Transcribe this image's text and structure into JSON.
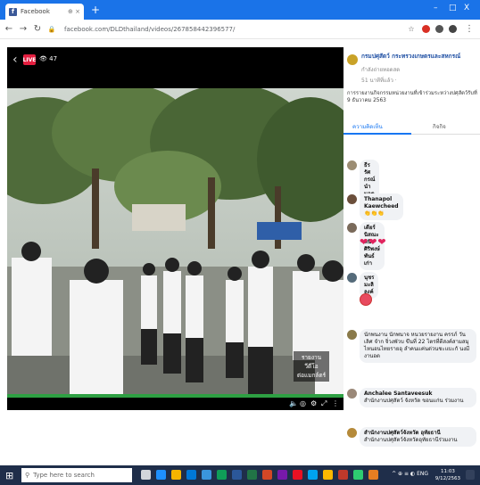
{
  "browser": {
    "tab_title": "Facebook",
    "tab_icons": "⊕ ×",
    "new_tab": "+",
    "window_controls": [
      "–",
      "□",
      "X"
    ],
    "url": "facebook.com/DLDthailand/videos/267858442396577/"
  },
  "player": {
    "viewers": "47",
    "caption_lines": [
      "รายงานวีดีโอ",
      "ต่อแมกล์ตร์"
    ]
  },
  "side": {
    "page_name": "กรมปศุสัตว์ กระทรวงเกษตรและสหกรณ์",
    "page_sub": "กำลังถ่ายทอดสด",
    "time": "51 นาทีที่แล้ว ·",
    "description": "การรายงานกิจกรรมหน่วยงานที่เข้าร่วมระหว่างปศุสัตว์รับที่ 9 ธันวาคม 2563",
    "tab_comments": "ความคิดเห็น",
    "tab_other": "กิจกิจ",
    "comments": [
      {
        "name": "ธีรรัศกรณ์ นำนอต",
        "text": ""
      },
      {
        "name": "Thanapol Kaewcheed",
        "text": "👏👏👏"
      },
      {
        "name": "เดียร์ นิสณะพินิจ ศิริพงษ์ พันธ์เก่า",
        "text": ""
      },
      {
        "name": "นุชร มะลิลงค์",
        "text": ""
      },
      {
        "name": "",
        "text": "นักพนงาน นักพนาจ หนวยรายงาน ครรภ์ วันเลิศ จำก จิ่วงพัวบ ขึนที่ 22 ไตรที่ตีสงค์สามสมุ ไหนอนไทยรายอุ ลำคนแค่นด่วนชะแบะกั นงมีงานอต"
      },
      {
        "name": "Anchalee Santaveesuk",
        "text": "สำนักงานปศุสัตว์ จังหวัด ขอนแก่น ร่วมงาน"
      },
      {
        "name": "สำนักงานปศุสัตว์จังหวัด อุทัยธานี",
        "text": "สำนักงานปศุสัตว์จังหวัดอุทัยธานีร่วมงาน"
      }
    ]
  },
  "taskbar": {
    "search_placeholder": "Type here to search",
    "tray": "^ ⊕ ≡ ◐ ENG",
    "clock_time": "11:03",
    "clock_date": "9/12/2563"
  },
  "colors": {
    "tab_strip": "#1a73e8",
    "facebook": "#3b5998",
    "progress": "#2ea043",
    "link": "#1877f2",
    "taskbar": "#1f2e4a"
  }
}
